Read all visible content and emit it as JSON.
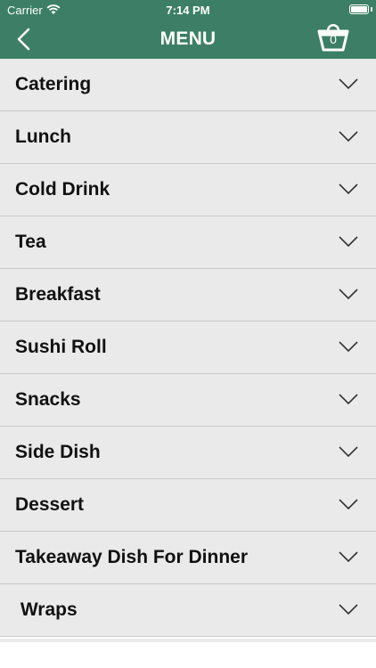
{
  "status": {
    "carrier": "Carrier",
    "time": "7:14 PM"
  },
  "header": {
    "title": "MENU",
    "cart_count": "0"
  },
  "menu": {
    "items": [
      {
        "label": "Catering"
      },
      {
        "label": "Lunch"
      },
      {
        "label": "Cold Drink"
      },
      {
        "label": "Tea"
      },
      {
        "label": "Breakfast"
      },
      {
        "label": "Sushi Roll"
      },
      {
        "label": "Snacks"
      },
      {
        "label": "Side Dish"
      },
      {
        "label": "Dessert"
      },
      {
        "label": "Takeaway Dish For Dinner"
      },
      {
        "label": " Wraps"
      }
    ]
  },
  "colors": {
    "header_bg": "#3c7f66",
    "row_bg": "#eaeaea",
    "divider": "#c9c9c9"
  },
  "icons": {
    "back": "back-chevron-icon",
    "cart": "shopping-basket-icon",
    "expand": "chevron-down-icon"
  }
}
